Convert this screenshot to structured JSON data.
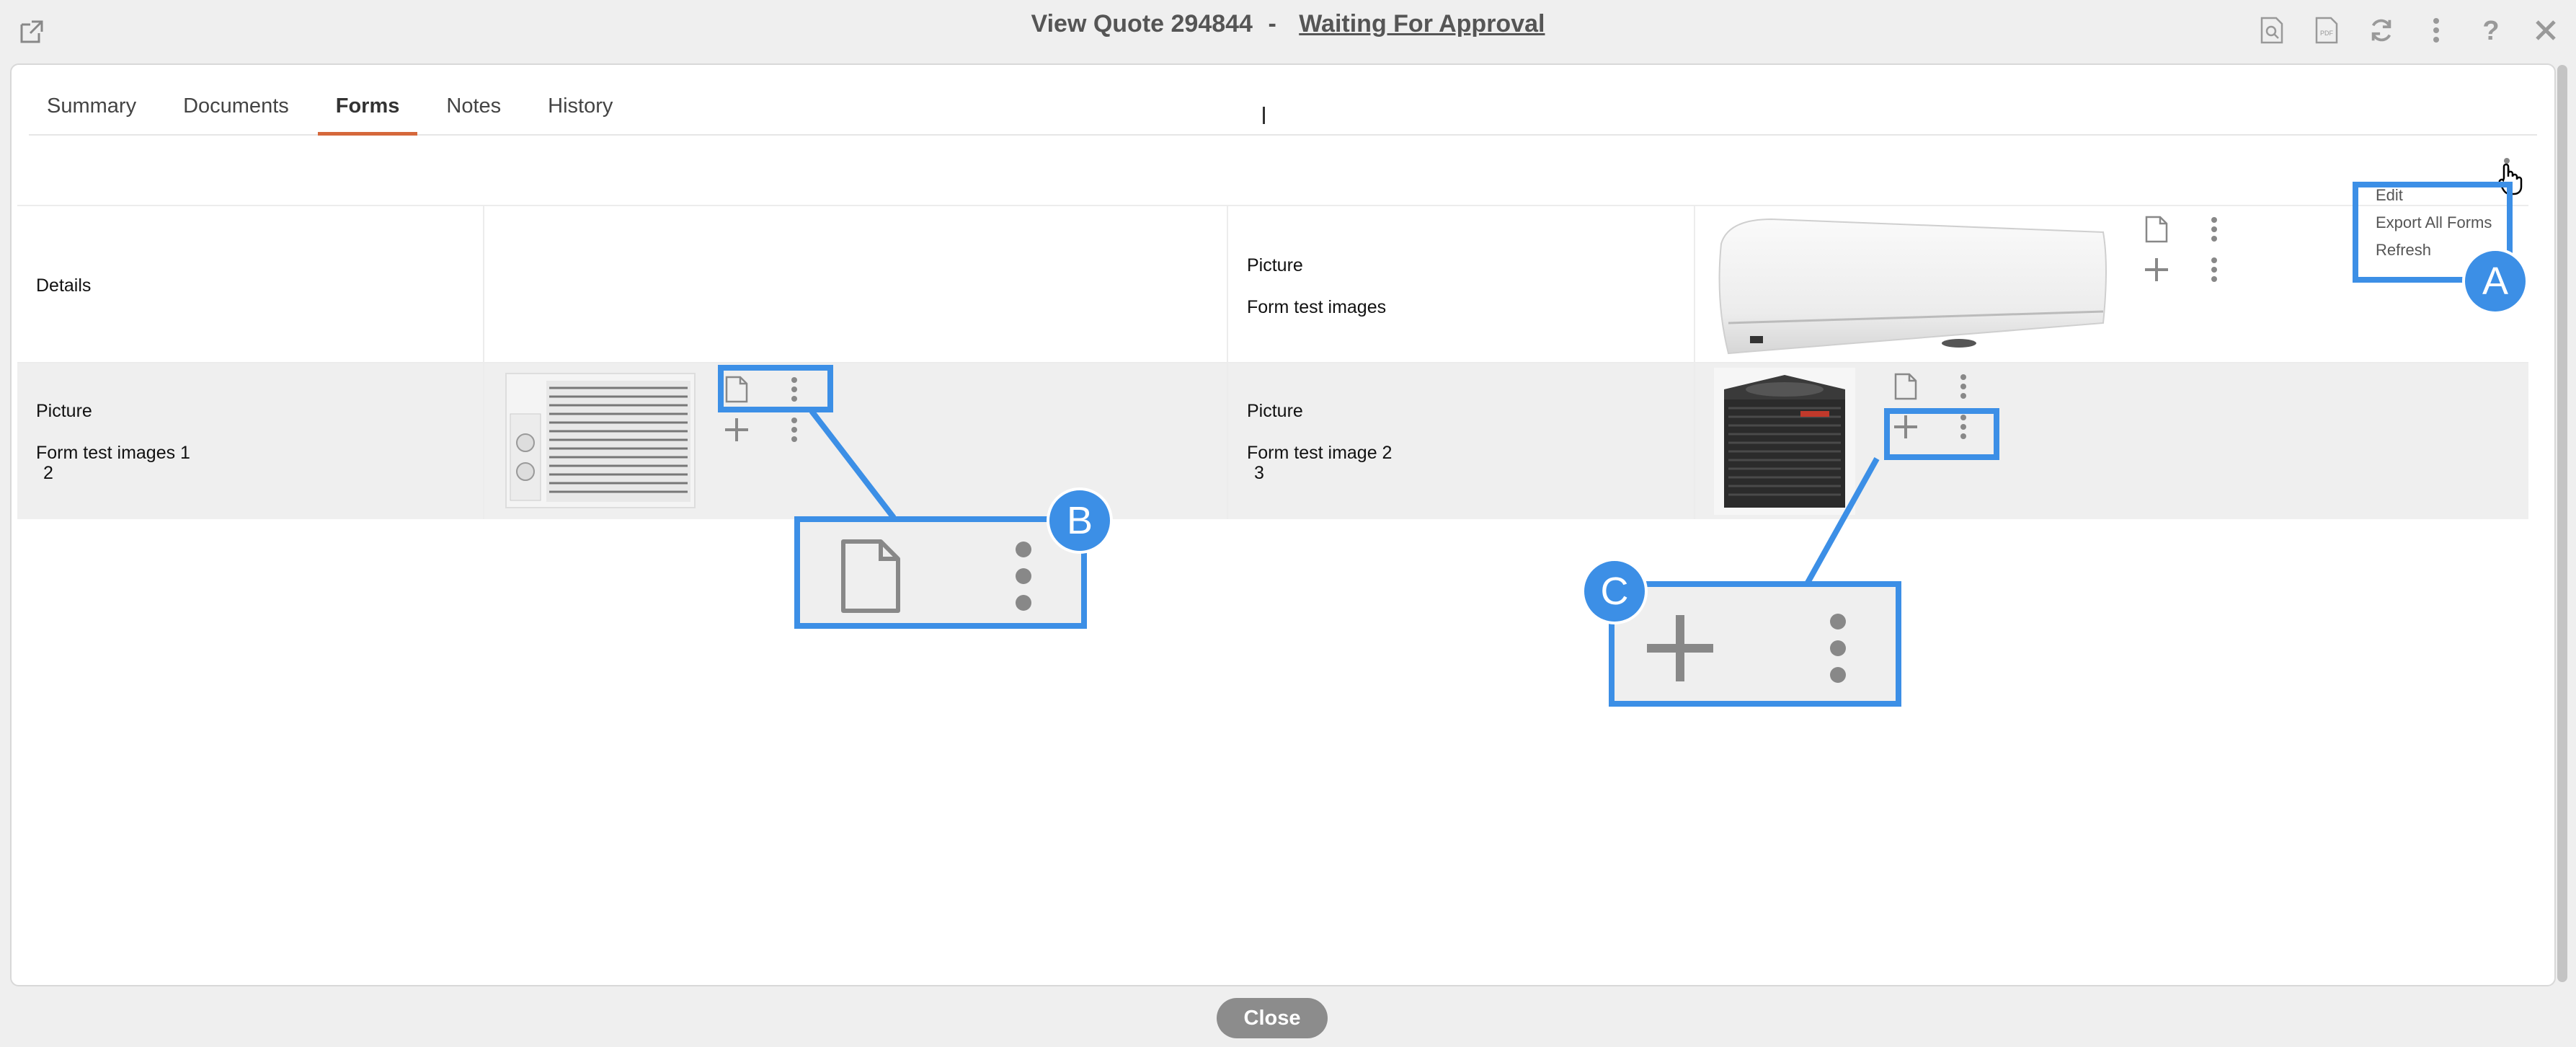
{
  "window": {
    "title_prefix": "View Quote",
    "quote_number": "294844",
    "separator": "-",
    "status": "Waiting For Approval",
    "toolbar_icons": [
      "preview-icon",
      "pdf-icon",
      "refresh-icon",
      "more-vertical-icon",
      "help-icon",
      "close-icon"
    ]
  },
  "tabs": [
    {
      "label": "Summary"
    },
    {
      "label": "Documents"
    },
    {
      "label": "Forms",
      "active": true
    },
    {
      "label": "Notes"
    },
    {
      "label": "History"
    }
  ],
  "dropdown": {
    "items": [
      "Edit",
      "Export All Forms",
      "Refresh"
    ]
  },
  "table": {
    "row1": {
      "col1_label": "Details",
      "col3_title": "Picture",
      "col3_sub": "Form test images"
    },
    "row2": {
      "col1_title": "Picture",
      "col1_sub": "Form test images 1",
      "col1_num": "2",
      "col3_title": "Picture",
      "col3_sub": "Form test image 2",
      "col3_num": "3"
    }
  },
  "callouts": {
    "a": "A",
    "b": "B",
    "c": "C"
  },
  "footer": {
    "close_label": "Close"
  },
  "colors": {
    "accent": "#d5683b",
    "callout": "#3c8fe6"
  }
}
